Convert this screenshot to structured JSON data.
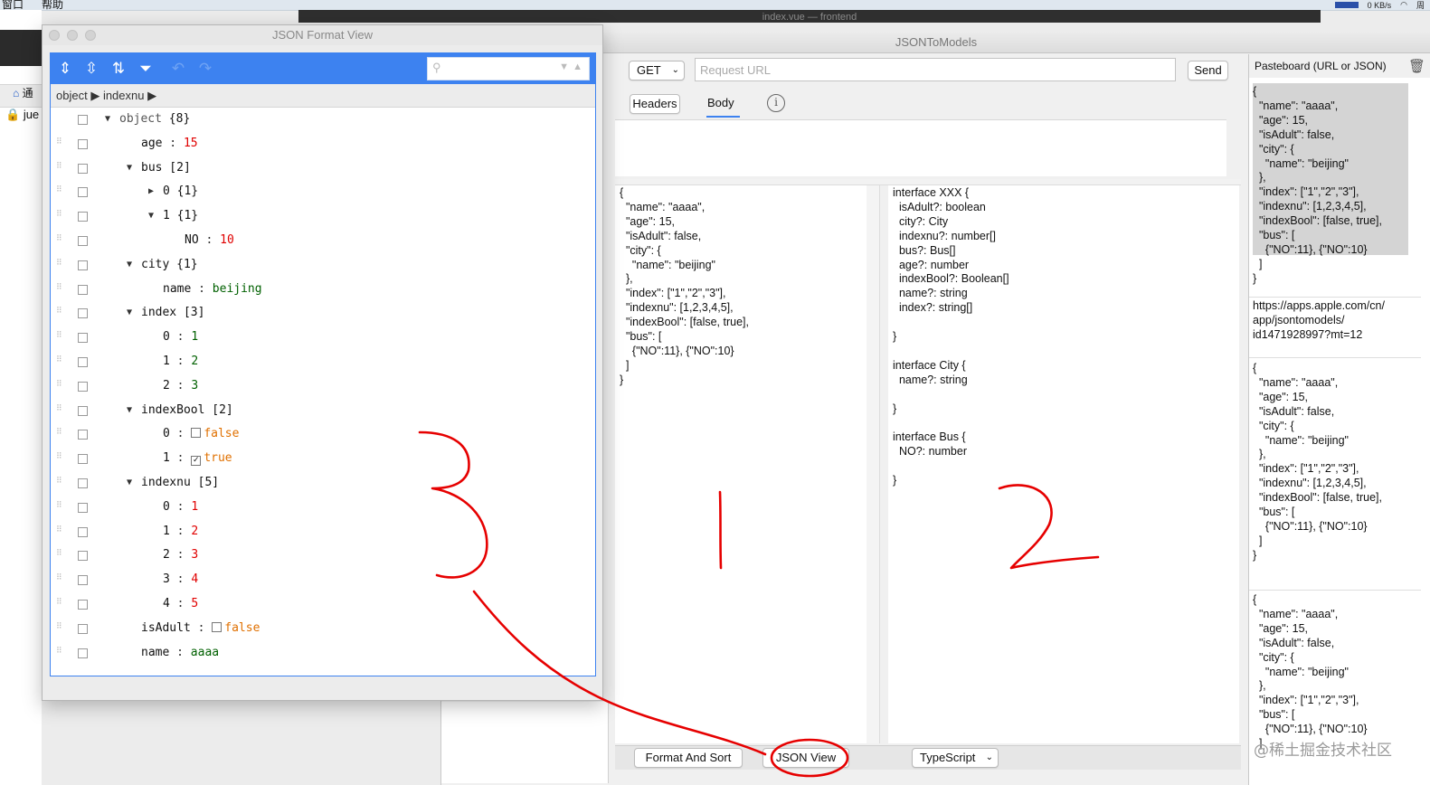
{
  "menubar": {
    "items": [
      "窗口",
      "帮助"
    ],
    "net_speed": "0 KB/s",
    "clock_char": "周"
  },
  "editor": {
    "title": "index.vue — frontend"
  },
  "left_bg": {
    "tab1": "通",
    "tab2": "jue"
  },
  "main_window": {
    "title": "JSONToModels",
    "method": "GET",
    "url_placeholder": "Request URL",
    "send_label": "Send",
    "tabs": [
      "Headers",
      "Body"
    ],
    "info_icon": "info-icon",
    "json_input": "{\n  \"name\": \"aaaa\",\n  \"age\": 15,\n  \"isAdult\": false,\n  \"city\": {\n    \"name\": \"beijing\"\n  },\n  \"index\": [\"1\",\"2\",\"3\"],\n  \"indexnu\": [1,2,3,4,5],\n  \"indexBool\": [false, true],\n  \"bus\": [\n    {\"NO\":11}, {\"NO\":10}\n  ]\n}",
    "output": "interface XXX {\n  isAdult?: boolean\n  city?: City\n  indexnu?: number[]\n  bus?: Bus[]\n  age?: number\n  indexBool?: Boolean[]\n  name?: string\n  index?: string[]\n\n}\n\ninterface City {\n  name?: string\n\n}\n\ninterface Bus {\n  NO?: number\n\n}",
    "format_button": "Format And Sort",
    "json_view_button": "JSON View",
    "language": "TypeScript"
  },
  "pasteboard": {
    "header": "Pasteboard (URL or JSON)",
    "items": [
      "{\n  \"name\": \"aaaa\",\n  \"age\": 15,\n  \"isAdult\": false,\n  \"city\": {\n    \"name\": \"beijing\"\n  },\n  \"index\": [\"1\",\"2\",\"3\"],\n  \"indexnu\": [1,2,3,4,5],\n  \"indexBool\": [false, true],\n  \"bus\": [\n    {\"NO\":11}, {\"NO\":10}\n  ]\n}",
      "https://apps.apple.com/cn/\napp/jsontomodels/\nid1471928997?mt=12",
      "{\n  \"name\": \"aaaa\",\n  \"age\": 15,\n  \"isAdult\": false,\n  \"city\": {\n    \"name\": \"beijing\"\n  },\n  \"index\": [\"1\",\"2\",\"3\"],\n  \"indexnu\": [1,2,3,4,5],\n  \"indexBool\": [false, true],\n  \"bus\": [\n    {\"NO\":11}, {\"NO\":10}\n  ]\n}",
      "{\n  \"name\": \"aaaa\",\n  \"age\": 15,\n  \"isAdult\": false,\n  \"city\": {\n    \"name\": \"beijing\"\n  },\n  \"index\": [\"1\",\"2\",\"3\"],\n  \"bus\": [\n    {\"NO\":11}, {\"NO\":10}\n  ]"
    ]
  },
  "format_window": {
    "title": "JSON Format View",
    "breadcrumb": [
      "object",
      "indexnu"
    ],
    "tree": [
      {
        "depth": 0,
        "toggle": "open",
        "key": "object",
        "count": "{8}"
      },
      {
        "depth": 1,
        "key": "age",
        "value": "15",
        "vtype": "num"
      },
      {
        "depth": 1,
        "toggle": "open",
        "key": "bus",
        "count": "[2]"
      },
      {
        "depth": 2,
        "toggle": "closed",
        "key": "0",
        "count": "{1}"
      },
      {
        "depth": 2,
        "toggle": "open",
        "key": "1",
        "count": "{1}"
      },
      {
        "depth": 3,
        "key": "NO",
        "value": "10",
        "vtype": "num"
      },
      {
        "depth": 1,
        "toggle": "open",
        "key": "city",
        "count": "{1}"
      },
      {
        "depth": 2,
        "key": "name",
        "value": "beijing",
        "vtype": "str"
      },
      {
        "depth": 1,
        "toggle": "open",
        "key": "index",
        "count": "[3]"
      },
      {
        "depth": 2,
        "key": "0",
        "value": "1",
        "vtype": "str"
      },
      {
        "depth": 2,
        "key": "1",
        "value": "2",
        "vtype": "str"
      },
      {
        "depth": 2,
        "key": "2",
        "value": "3",
        "vtype": "str"
      },
      {
        "depth": 1,
        "toggle": "open",
        "key": "indexBool",
        "count": "[2]"
      },
      {
        "depth": 2,
        "key": "0",
        "value": "false",
        "vtype": "bool",
        "checked": false
      },
      {
        "depth": 2,
        "key": "1",
        "value": "true",
        "vtype": "bool",
        "checked": true
      },
      {
        "depth": 1,
        "toggle": "open",
        "key": "indexnu",
        "count": "[5]"
      },
      {
        "depth": 2,
        "key": "0",
        "value": "1",
        "vtype": "num"
      },
      {
        "depth": 2,
        "key": "1",
        "value": "2",
        "vtype": "num"
      },
      {
        "depth": 2,
        "key": "2",
        "value": "3",
        "vtype": "num"
      },
      {
        "depth": 2,
        "key": "3",
        "value": "4",
        "vtype": "num"
      },
      {
        "depth": 2,
        "key": "4",
        "value": "5",
        "vtype": "num"
      },
      {
        "depth": 1,
        "key": "isAdult",
        "value": "false",
        "vtype": "bool",
        "checked": false
      },
      {
        "depth": 1,
        "key": "name",
        "value": "aaaa",
        "vtype": "str"
      }
    ]
  },
  "annotations": {
    "labels": [
      "1",
      "2",
      "3"
    ],
    "color": "#e60000"
  },
  "watermark": "@稀土掘金技术社区"
}
